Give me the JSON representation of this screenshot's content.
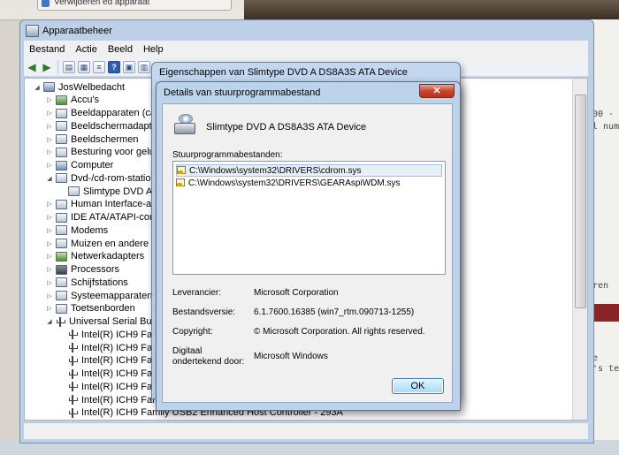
{
  "background": {
    "browser_tab": "Verwijderen ed apparaat",
    "right_panel_lines": [
      "00 -",
      "l num",
      "ren",
      "e",
      "'s te"
    ]
  },
  "device_manager": {
    "title": "Apparaatbeheer",
    "menu": [
      "Bestand",
      "Actie",
      "Beeld",
      "Help"
    ],
    "tree": [
      {
        "label": "JosWelbedacht",
        "level": 0,
        "expander": "◢",
        "icon": "pc"
      },
      {
        "label": "Accu's",
        "level": 1,
        "expander": "▷",
        "icon": "green"
      },
      {
        "label": "Beeldapparaten (camera",
        "level": 1,
        "expander": "▷",
        "icon": "default"
      },
      {
        "label": "Beeldschermadapters",
        "level": 1,
        "expander": "▷",
        "icon": "default"
      },
      {
        "label": "Beeldschermen",
        "level": 1,
        "expander": "▷",
        "icon": "default"
      },
      {
        "label": "Besturing voor geluid",
        "level": 1,
        "expander": "▷",
        "icon": "default"
      },
      {
        "label": "Computer",
        "level": 1,
        "expander": "▷",
        "icon": "pc"
      },
      {
        "label": "Dvd-/cd-rom-station",
        "level": 1,
        "expander": "◢",
        "icon": "default"
      },
      {
        "label": "Slimtype DVD A  D",
        "level": 2,
        "expander": "",
        "icon": "default"
      },
      {
        "label": "Human Interface-appa",
        "level": 1,
        "expander": "▷",
        "icon": "default"
      },
      {
        "label": "IDE ATA/ATAPI-contr",
        "level": 1,
        "expander": "▷",
        "icon": "default"
      },
      {
        "label": "Modems",
        "level": 1,
        "expander": "▷",
        "icon": "default"
      },
      {
        "label": "Muizen en andere aan",
        "level": 1,
        "expander": "▷",
        "icon": "default"
      },
      {
        "label": "Netwerkadapters",
        "level": 1,
        "expander": "▷",
        "icon": "green"
      },
      {
        "label": "Processors",
        "level": 1,
        "expander": "▷",
        "icon": "dark"
      },
      {
        "label": "Schijfstations",
        "level": 1,
        "expander": "▷",
        "icon": "default"
      },
      {
        "label": "Systeemapparaten",
        "level": 1,
        "expander": "▷",
        "icon": "default"
      },
      {
        "label": "Toetsenborden",
        "level": 1,
        "expander": "▷",
        "icon": "default"
      },
      {
        "label": "Universal Serial Bus-co",
        "level": 1,
        "expander": "◢",
        "icon": "usb"
      },
      {
        "label": "Intel(R) ICH9 Fami",
        "level": 2,
        "expander": "",
        "icon": "usb"
      },
      {
        "label": "Intel(R) ICH9 Fami",
        "level": 2,
        "expander": "",
        "icon": "usb"
      },
      {
        "label": "Intel(R) ICH9 Fami",
        "level": 2,
        "expander": "",
        "icon": "usb"
      },
      {
        "label": "Intel(R) ICH9 Fami",
        "level": 2,
        "expander": "",
        "icon": "usb"
      },
      {
        "label": "Intel(R) ICH9 Fami",
        "level": 2,
        "expander": "",
        "icon": "usb"
      },
      {
        "label": "Intel(R) ICH9 Fami",
        "level": 2,
        "expander": "",
        "icon": "usb"
      },
      {
        "label": "Intel(R) ICH9 Family USB2 Enhanced Host Controller - 293A",
        "level": 2,
        "expander": "",
        "icon": "usb"
      }
    ]
  },
  "properties_dialog": {
    "title": "Eigenschappen van Slimtype DVD A  DS8A3S ATA Device"
  },
  "driver_details": {
    "title": "Details van stuurprogrammabestand",
    "close_glyph": "✕",
    "device_name": "Slimtype DVD A  DS8A3S ATA Device",
    "files_label": "Stuurprogrammabestanden:",
    "files": [
      "C:\\Windows\\system32\\DRIVERS\\cdrom.sys",
      "C:\\Windows\\system32\\DRIVERS\\GEARAspiWDM.sys"
    ],
    "info": {
      "provider_label": "Leverancier:",
      "provider_value": "Microsoft Corporation",
      "version_label": "Bestandsversie:",
      "version_value": "6.1.7600.16385 (win7_rtm.090713-1255)",
      "copyright_label": "Copyright:",
      "copyright_value": "© Microsoft Corporation. All rights reserved.",
      "signer_label_1": "Digitaal",
      "signer_label_2": "ondertekend door:",
      "signer_value": "Microsoft Windows"
    },
    "ok_label": "OK"
  }
}
